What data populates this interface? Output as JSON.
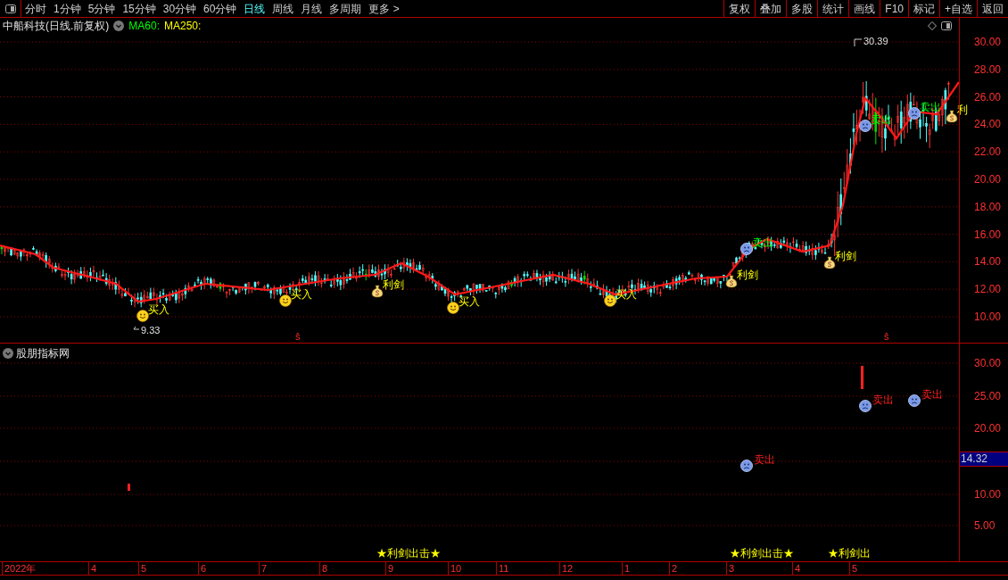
{
  "toolbar": {
    "periods": [
      {
        "label": "分时",
        "selected": false
      },
      {
        "label": "1分钟",
        "selected": false
      },
      {
        "label": "5分钟",
        "selected": false
      },
      {
        "label": "15分钟",
        "selected": false
      },
      {
        "label": "30分钟",
        "selected": false
      },
      {
        "label": "60分钟",
        "selected": false
      },
      {
        "label": "日线",
        "selected": true
      },
      {
        "label": "周线",
        "selected": false
      },
      {
        "label": "月线",
        "selected": false
      },
      {
        "label": "多周期",
        "selected": false
      },
      {
        "label": "更多 >",
        "selected": false
      }
    ],
    "actions": [
      "复权",
      "叠加",
      "多股",
      "统计",
      "画线",
      "F10",
      "标记",
      "+自选",
      "返回"
    ]
  },
  "chart": {
    "title": "中船科技(日线.前复权)",
    "indicators": [
      {
        "label": "MA60:",
        "color": "#00ff00"
      },
      {
        "label": "MA250:",
        "color": "#ffff00"
      }
    ],
    "y_axis": [
      "30.00",
      "28.00",
      "26.00",
      "24.00",
      "22.00",
      "20.00",
      "18.00",
      "16.00",
      "14.00",
      "12.00",
      "10.00"
    ],
    "high_label": "30.39",
    "low_label": "9.33",
    "signals": [
      {
        "kind": "buy",
        "label": "买入"
      },
      {
        "kind": "buy",
        "label": "买入"
      },
      {
        "kind": "sword",
        "label": "利剑"
      },
      {
        "kind": "buy",
        "label": "买入"
      },
      {
        "kind": "buy",
        "label": "买入"
      },
      {
        "kind": "sword",
        "label": "利剑"
      },
      {
        "kind": "sell",
        "label": "卖出"
      },
      {
        "kind": "sword",
        "label": "利剑"
      },
      {
        "kind": "sell",
        "label": "卖出"
      },
      {
        "kind": "sell",
        "label": "卖出"
      },
      {
        "kind": "sword",
        "label": "利"
      }
    ],
    "marks": [
      "ŝ",
      "ŝ"
    ]
  },
  "indicator_panel": {
    "title": "股朋指标网",
    "y_axis": [
      "30.00",
      "25.00",
      "20.00",
      "10.00",
      "5.00"
    ],
    "current_value": "14.32",
    "signals": [
      {
        "kind": "sell",
        "label": "卖出"
      },
      {
        "kind": "sell",
        "label": "卖出"
      },
      {
        "kind": "sell",
        "label": "卖出"
      }
    ],
    "banners": [
      "★利剑出击★",
      "★利剑出击★",
      "★利剑出"
    ]
  },
  "date_axis": [
    "2022年",
    "4",
    "5",
    "6",
    "7",
    "8",
    "9",
    "10",
    "11",
    "12",
    "1",
    "2",
    "3",
    "4",
    "5"
  ]
}
